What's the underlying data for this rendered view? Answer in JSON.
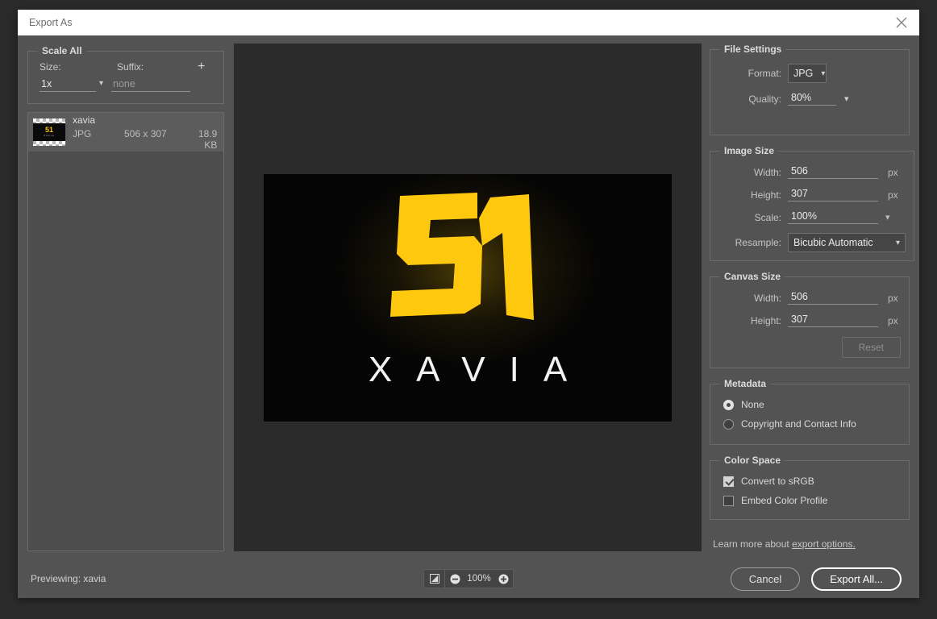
{
  "window": {
    "title": "Export As",
    "close_icon": "close-icon"
  },
  "scale_all": {
    "legend": "Scale All",
    "size_label": "Size:",
    "suffix_label": "Suffix:",
    "add_label": "+",
    "size_value": "1x",
    "suffix_value": "",
    "suffix_placeholder": "none"
  },
  "file_list": {
    "items": [
      {
        "name": "xavia",
        "format": "JPG",
        "dimensions": "506 x 307",
        "size": "18.9 KB",
        "thumb_label": "51",
        "thumb_sub": "XAVIA"
      }
    ]
  },
  "preview": {
    "logo_number": "51",
    "brand": "XAVIA",
    "brand_color": "#f2f2f2",
    "logo_color": "#fdc80d",
    "background": "#050505"
  },
  "file_settings": {
    "legend": "File Settings",
    "format_label": "Format:",
    "format_value": "JPG",
    "quality_label": "Quality:",
    "quality_value": "80%"
  },
  "image_size": {
    "legend": "Image Size",
    "width_label": "Width:",
    "width_value": "506",
    "width_unit": "px",
    "height_label": "Height:",
    "height_value": "307",
    "height_unit": "px",
    "scale_label": "Scale:",
    "scale_value": "100%",
    "resample_label": "Resample:",
    "resample_value": "Bicubic Automatic"
  },
  "canvas_size": {
    "legend": "Canvas Size",
    "width_label": "Width:",
    "width_value": "506",
    "width_unit": "px",
    "height_label": "Height:",
    "height_value": "307",
    "height_unit": "px",
    "reset_label": "Reset"
  },
  "metadata": {
    "legend": "Metadata",
    "options": [
      {
        "label": "None",
        "selected": true
      },
      {
        "label": "Copyright and Contact Info",
        "selected": false
      }
    ]
  },
  "color_space": {
    "legend": "Color Space",
    "options": [
      {
        "label": "Convert to sRGB",
        "checked": true
      },
      {
        "label": "Embed Color Profile",
        "checked": false
      }
    ]
  },
  "learn_more": {
    "text": "Learn more about ",
    "link": "export options."
  },
  "footer": {
    "previewing_label": "Previewing: xavia",
    "zoom_fit_icon": "fit-to-screen-icon",
    "zoom_out_icon": "zoom-out-icon",
    "zoom_value": "100%",
    "zoom_in_icon": "zoom-in-icon",
    "cancel_label": "Cancel",
    "export_label": "Export All..."
  }
}
